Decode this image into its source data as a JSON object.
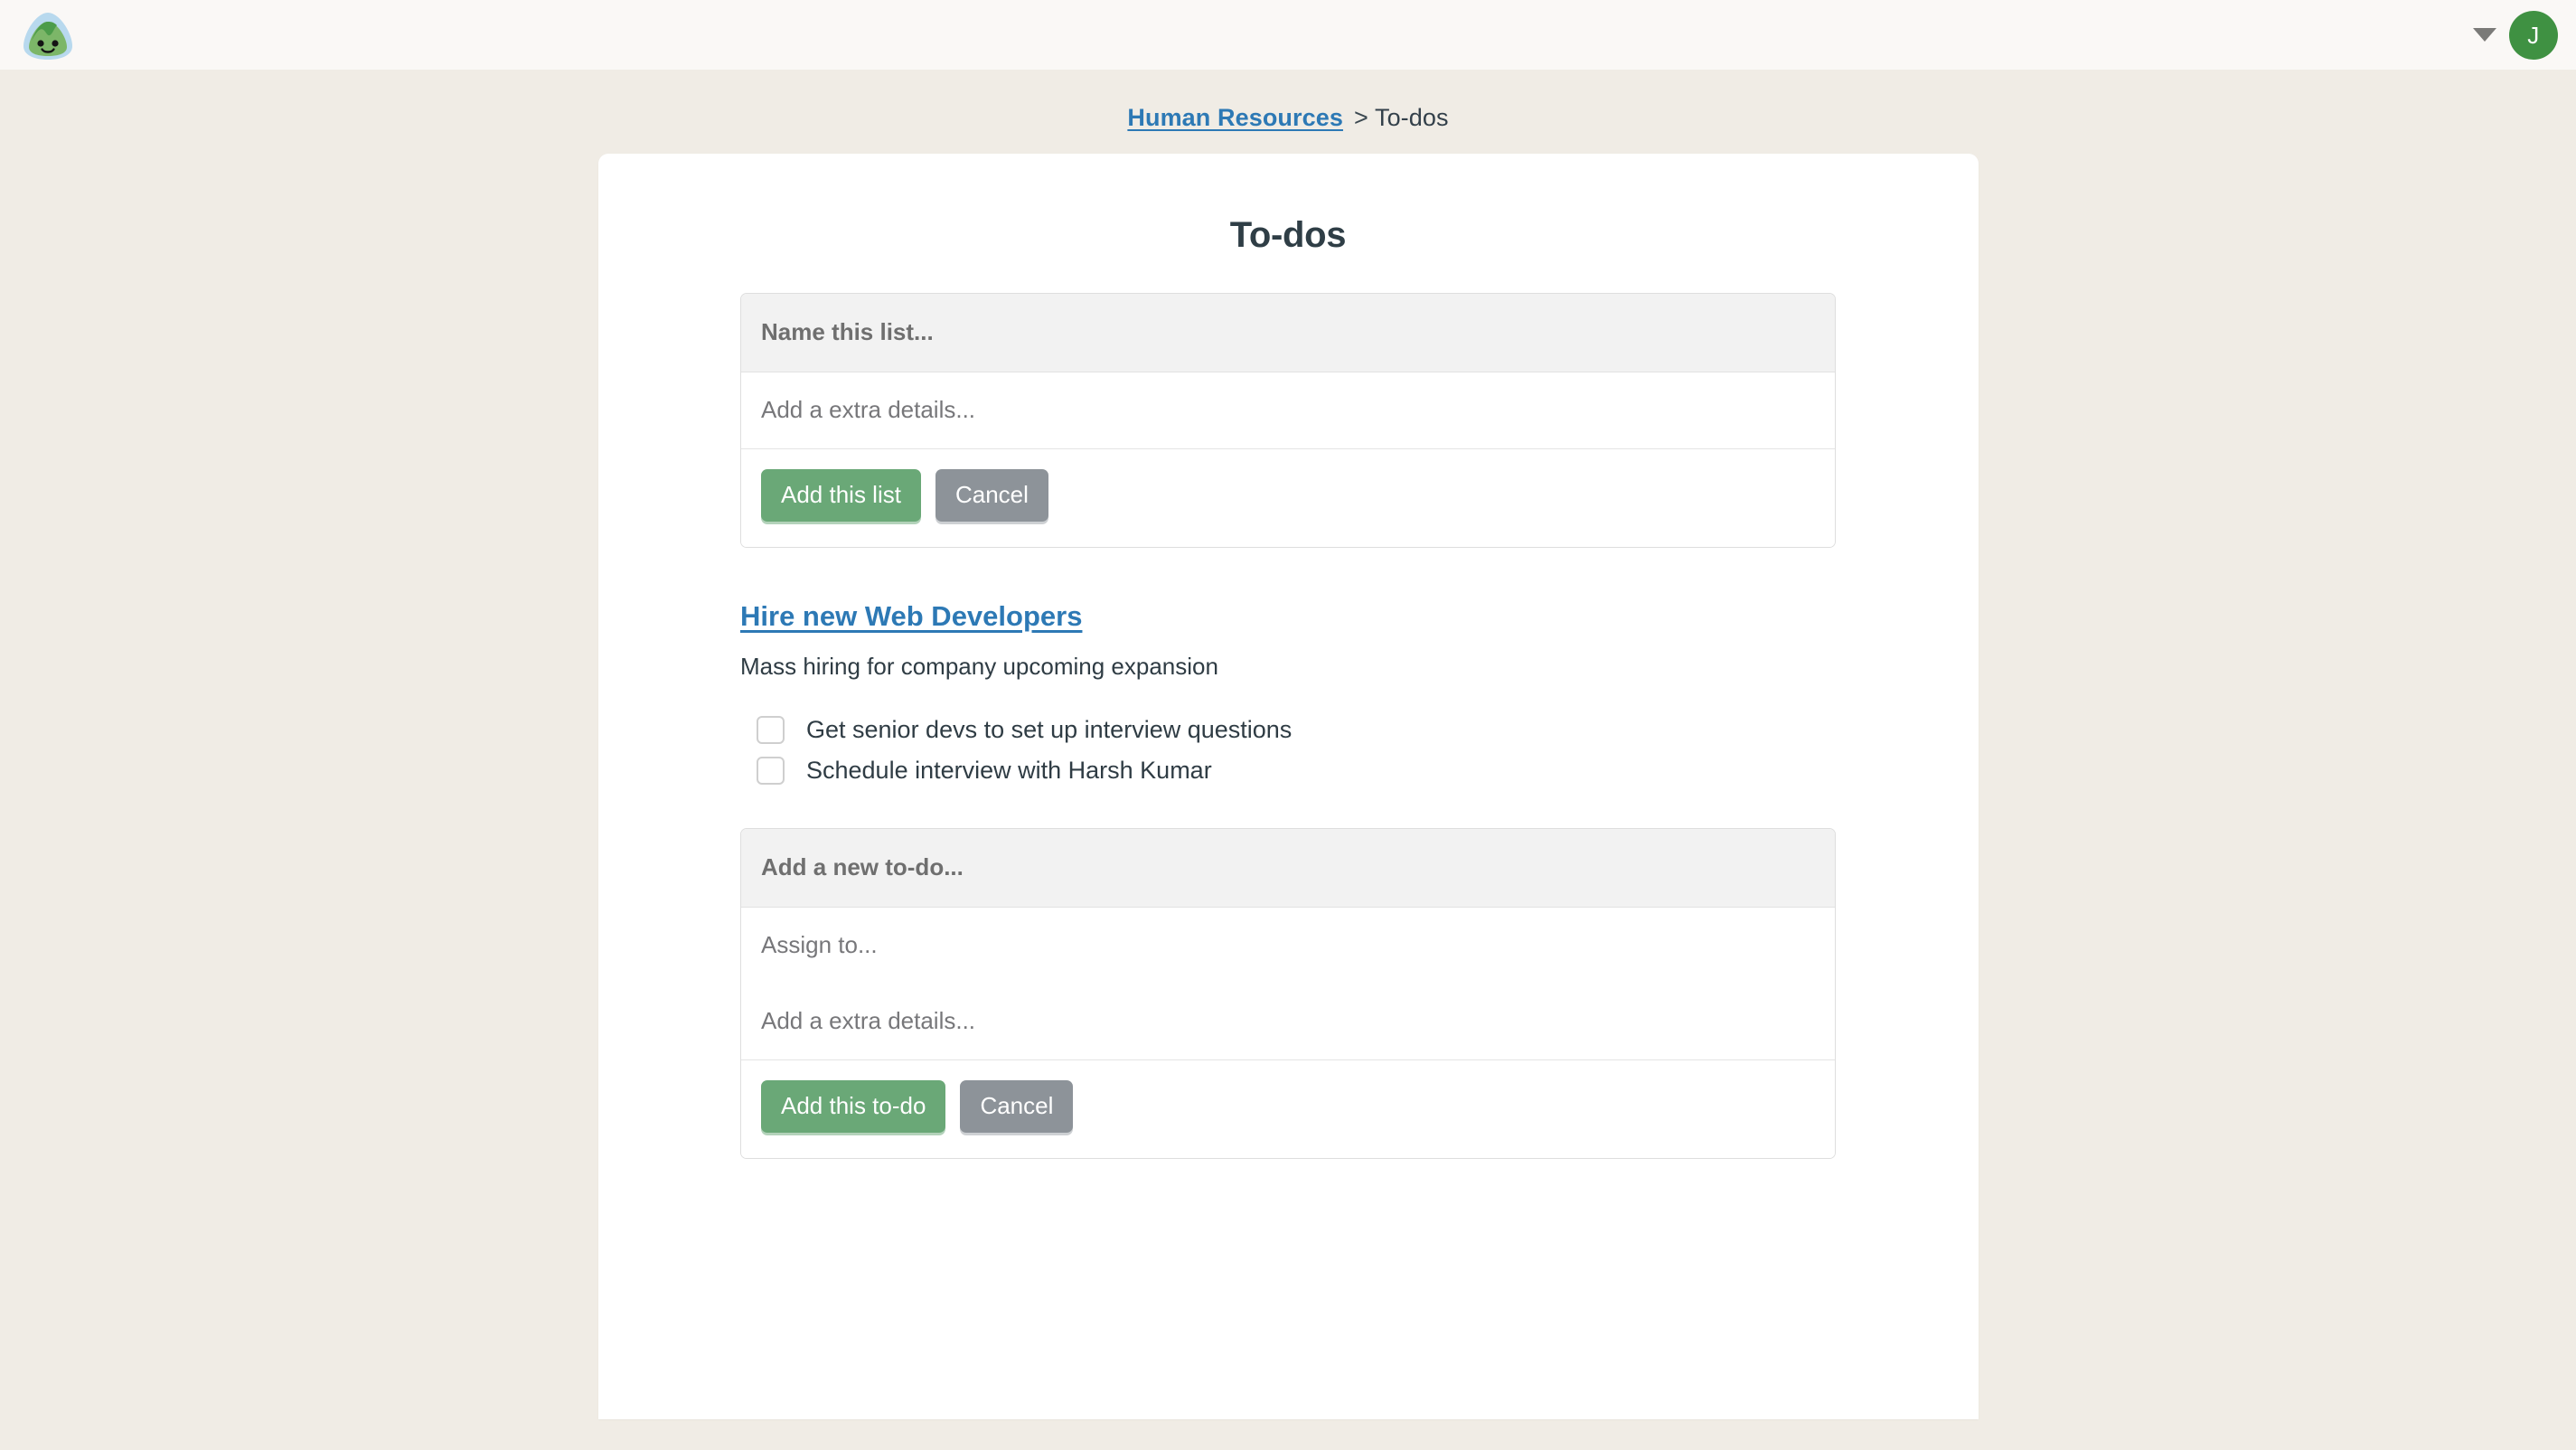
{
  "topbar": {
    "logo_icon": "basecamp-hill-logo",
    "menu_caret_icon": "chevron-down-icon",
    "avatar_initial": "J",
    "avatar_color": "#3f9142"
  },
  "breadcrumb": {
    "parent": "Human Resources",
    "separator": ">",
    "current": "To-dos"
  },
  "page": {
    "title": "To-dos"
  },
  "new_list_form": {
    "name_placeholder": "Name this list...",
    "details_placeholder": "Add a extra details...",
    "submit_label": "Add this list",
    "cancel_label": "Cancel"
  },
  "list": {
    "title": "Hire new Web Developers",
    "description": "Mass hiring for company upcoming expansion",
    "items": [
      {
        "label": "Get senior devs to set up interview questions",
        "checked": false
      },
      {
        "label": "Schedule interview with Harsh Kumar",
        "checked": false
      }
    ]
  },
  "new_todo_form": {
    "name_placeholder": "Add a new to-do...",
    "assign_placeholder": "Assign to...",
    "details_placeholder": "Add a extra details...",
    "submit_label": "Add this to-do",
    "cancel_label": "Cancel"
  },
  "colors": {
    "accent_green": "#6aa877",
    "link_blue": "#2d79b5",
    "page_bg": "#f0ece5",
    "card_bg": "#ffffff",
    "gray_button": "#8d9399"
  }
}
